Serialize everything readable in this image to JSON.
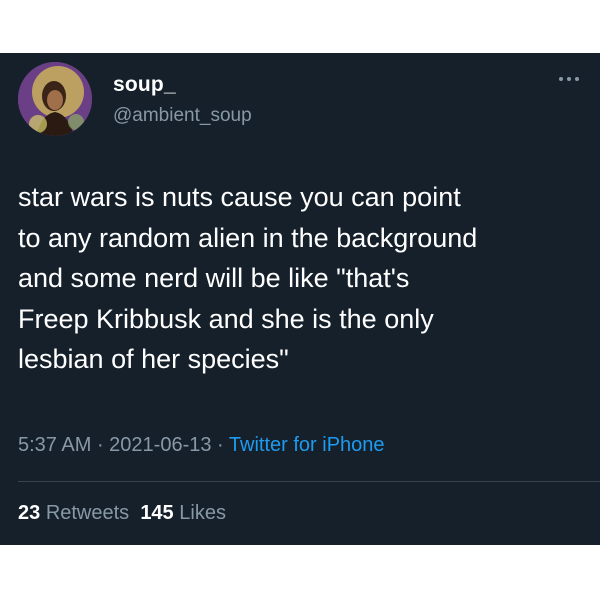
{
  "user": {
    "display_name": "soup_",
    "handle": "@ambient_soup"
  },
  "tweet": {
    "lines": [
      "star wars is nuts cause you can point",
      "to any random alien in the background",
      "and some nerd will be like \"that's",
      "Freep Kribbusk and she is the only",
      "lesbian of her species\""
    ]
  },
  "meta": {
    "time": "5:37 AM",
    "sep1": " · ",
    "date": "2021-06-13",
    "sep2": " · ",
    "source": "Twitter for iPhone"
  },
  "stats": {
    "retweets_count": "23",
    "retweets_label": "Retweets",
    "likes_count": "145",
    "likes_label": "Likes"
  },
  "icons": {
    "more": "more-icon",
    "avatar": "avatar"
  },
  "colors": {
    "background": "#15202b",
    "text": "#ffffff",
    "secondary": "#8899a6",
    "link": "#1d9bf0",
    "divider": "#38444d"
  }
}
